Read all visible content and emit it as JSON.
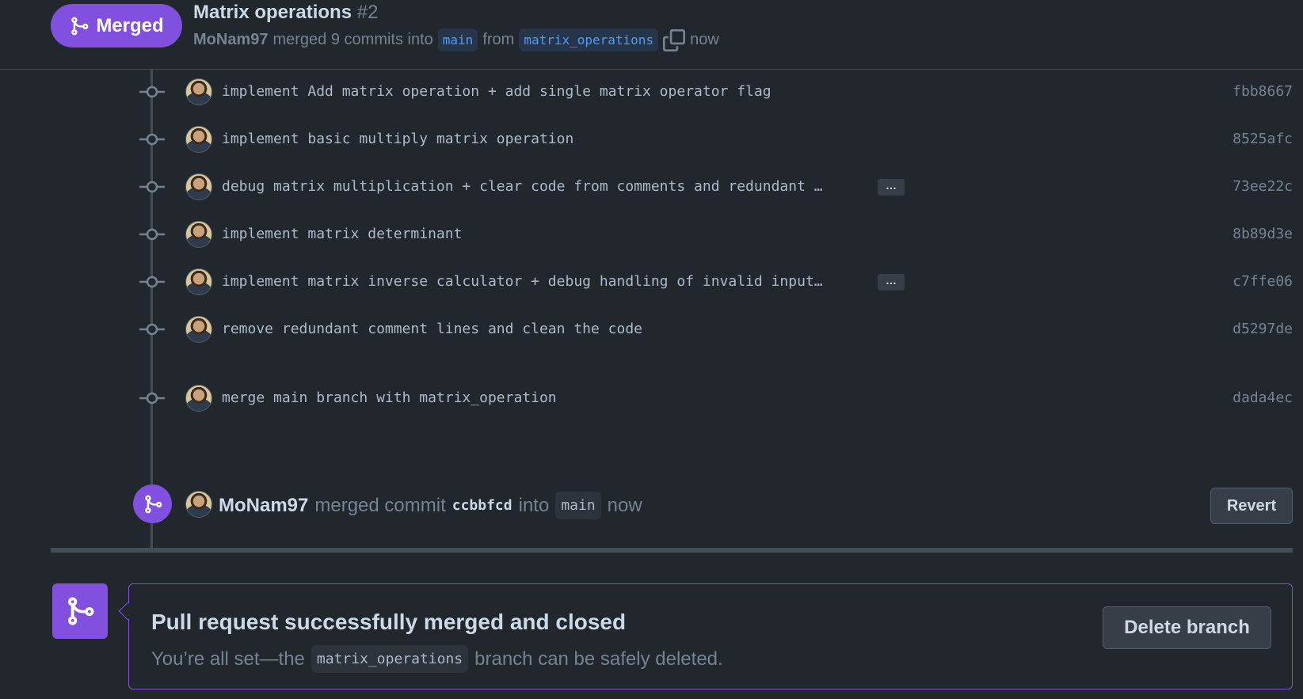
{
  "header": {
    "status_label": "Merged",
    "title": "Matrix operations",
    "number": "#2",
    "author": "MoNam97",
    "merged_text": "merged 9 commits into",
    "base_branch": "main",
    "from_text": "from",
    "head_branch": "matrix_operations",
    "time": "now",
    "copy_icon": "copy-icon",
    "merge_icon": "git-merge-icon"
  },
  "commits": [
    {
      "message": "implement Add matrix operation + add single matrix operator flag",
      "sha": "fbb8667",
      "has_more": false
    },
    {
      "message": "implement basic multiply matrix operation",
      "sha": "8525afc",
      "has_more": false
    },
    {
      "message": "debug matrix multiplication + clear code from comments and redundant …",
      "sha": "73ee22c",
      "has_more": true
    },
    {
      "message": "implement matrix determinant",
      "sha": "8b89d3e",
      "has_more": false
    },
    {
      "message": "implement matrix inverse calculator + debug handling of invalid input…",
      "sha": "c7ffe06",
      "has_more": true
    },
    {
      "message": "remove redundant comment lines and clean the code",
      "sha": "d5297de",
      "has_more": false
    },
    {
      "message": "merge main branch with matrix_operation",
      "sha": "dada4ec",
      "has_more": false
    }
  ],
  "more_label": "…",
  "merge_event": {
    "author": "MoNam97",
    "text1": "merged commit",
    "sha": "ccbbfcd",
    "text2": "into",
    "branch": "main",
    "time": "now",
    "revert_label": "Revert"
  },
  "final": {
    "heading": "Pull request successfully merged and closed",
    "desc_prefix": "You’re all set—the",
    "branch": "matrix_operations",
    "desc_suffix": "branch can be safely deleted.",
    "delete_label": "Delete branch"
  },
  "colors": {
    "accent_purple": "#8250df",
    "background": "#22272e",
    "link_blue": "#539bf5"
  }
}
